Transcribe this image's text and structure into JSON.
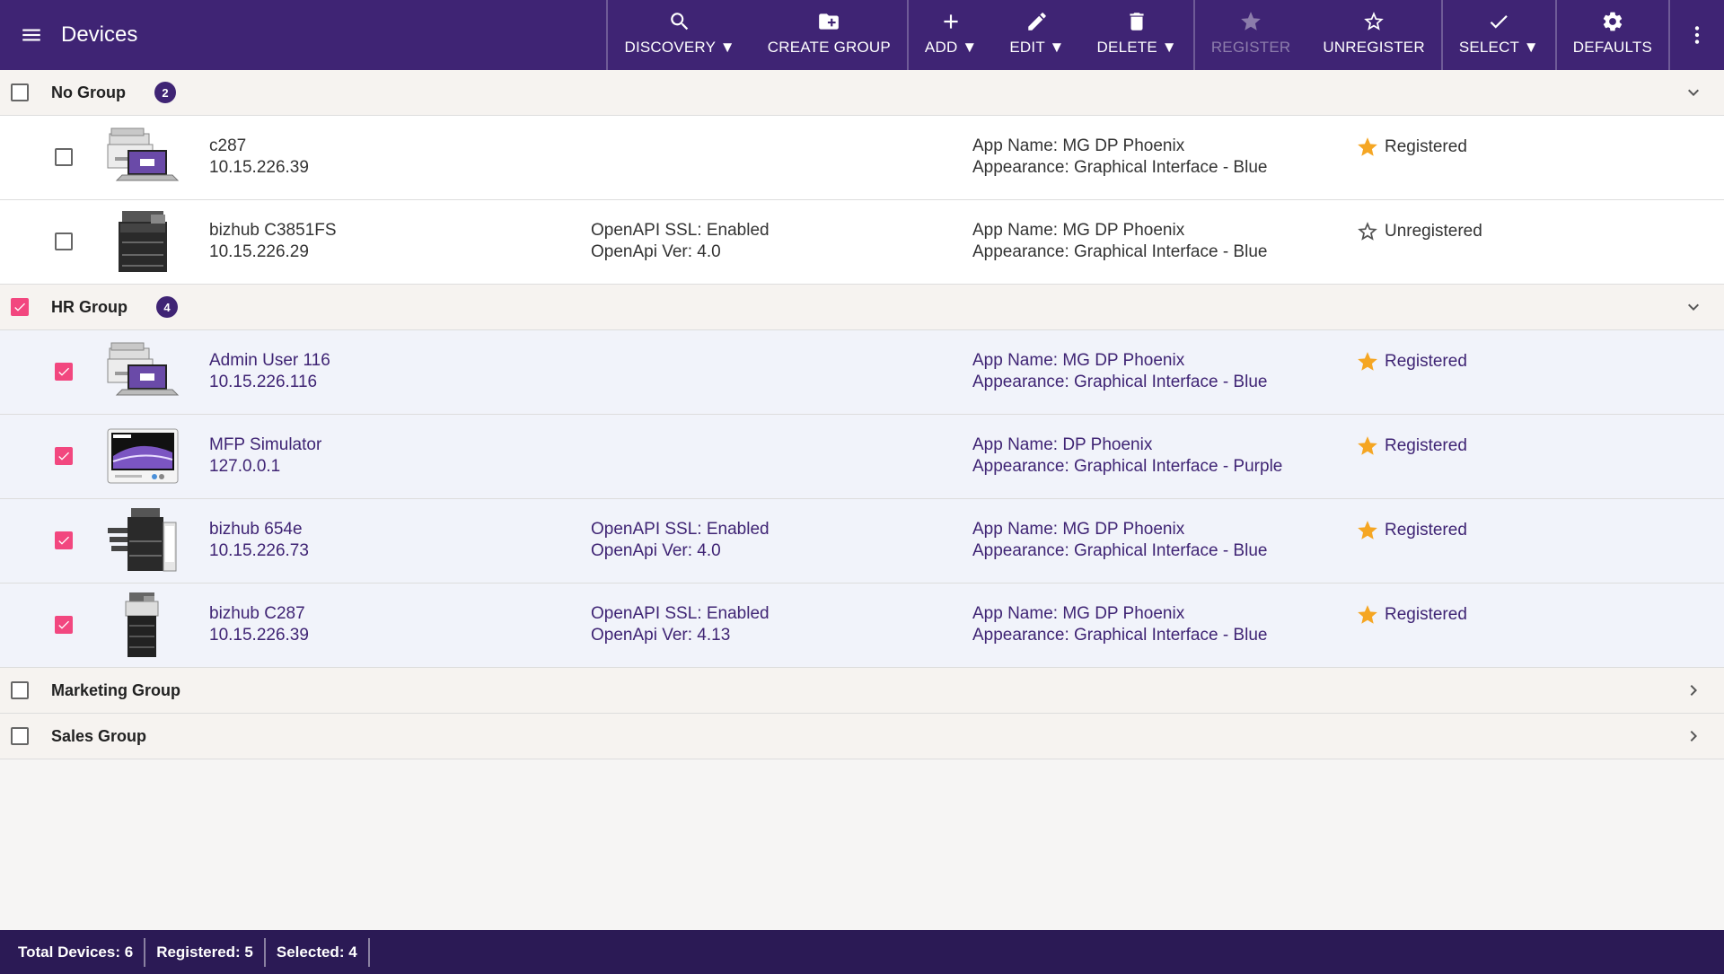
{
  "app": {
    "title": "Devices"
  },
  "toolbar": {
    "discovery": "DISCOVERY ▼",
    "create_group": "CREATE GROUP",
    "add": "ADD ▼",
    "edit": "EDIT ▼",
    "delete": "DELETE ▼",
    "register": "REGISTER",
    "unregister": "UNREGISTER",
    "select": "SELECT ▼",
    "defaults": "DEFAULTS"
  },
  "groups": [
    {
      "name": "No Group",
      "count": "2",
      "checked": false,
      "expanded": true,
      "devices": [
        {
          "name": "c287",
          "ip": "10.15.226.39",
          "ssl": "",
          "api": "",
          "app": "App Name: MG DP Phoenix",
          "appearance": "Appearance: Graphical Interface - Blue",
          "status": "Registered",
          "registered": true,
          "icon": "printer-laptop-icon",
          "checked": false
        },
        {
          "name": "bizhub C3851FS",
          "ip": "10.15.226.29",
          "ssl": "OpenAPI SSL: Enabled",
          "api": "OpenApi Ver: 4.0",
          "app": "App Name: MG DP Phoenix",
          "appearance": "Appearance: Graphical Interface - Blue",
          "status": "Unregistered",
          "registered": false,
          "icon": "mfp-printer-icon",
          "checked": false
        }
      ]
    },
    {
      "name": "HR Group",
      "count": "4",
      "checked": true,
      "expanded": true,
      "devices": [
        {
          "name": "Admin User 116",
          "ip": "10.15.226.116",
          "ssl": "",
          "api": "",
          "app": "App Name: MG DP Phoenix",
          "appearance": "Appearance: Graphical Interface - Blue",
          "status": "Registered",
          "registered": true,
          "icon": "printer-laptop-icon",
          "checked": true
        },
        {
          "name": "MFP Simulator",
          "ip": "127.0.0.1",
          "ssl": "",
          "api": "",
          "app": "App Name: DP Phoenix",
          "appearance": "Appearance: Graphical Interface - Purple",
          "status": "Registered",
          "registered": true,
          "icon": "simulator-panel-icon",
          "checked": true
        },
        {
          "name": "bizhub 654e",
          "ip": "10.15.226.73",
          "ssl": "OpenAPI SSL: Enabled",
          "api": "OpenApi Ver: 4.0",
          "app": "App Name: MG DP Phoenix",
          "appearance": "Appearance: Graphical Interface - Blue",
          "status": "Registered",
          "registered": true,
          "icon": "production-printer-icon",
          "checked": true
        },
        {
          "name": "bizhub C287",
          "ip": "10.15.226.39",
          "ssl": "OpenAPI SSL: Enabled",
          "api": "OpenApi Ver: 4.13",
          "app": "App Name: MG DP Phoenix",
          "appearance": "Appearance: Graphical Interface - Blue",
          "status": "Registered",
          "registered": true,
          "icon": "tower-printer-icon",
          "checked": true
        }
      ]
    },
    {
      "name": "Marketing Group",
      "count": "",
      "checked": false,
      "expanded": false,
      "devices": []
    },
    {
      "name": "Sales Group",
      "count": "",
      "checked": false,
      "expanded": false,
      "devices": []
    }
  ],
  "status": {
    "total": "Total Devices: 6",
    "registered": "Registered: 5",
    "selected": "Selected: 4"
  },
  "colors": {
    "appbar": "#3f2474",
    "statusbar": "#2b1a55",
    "check": "#f2477f",
    "star": "#f5a623",
    "selected_row": "#f1f3fa"
  }
}
